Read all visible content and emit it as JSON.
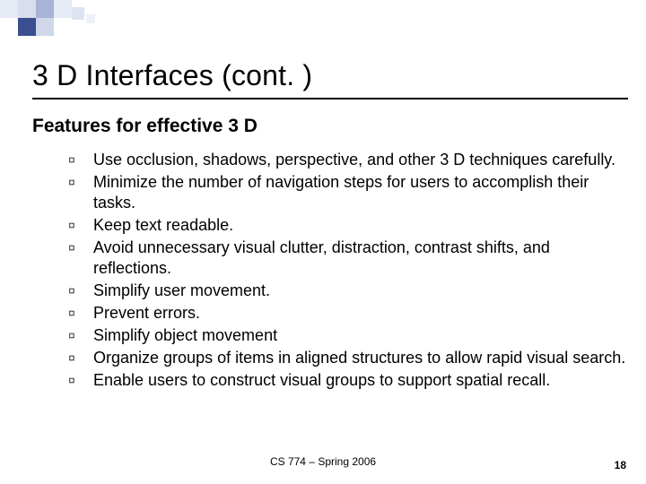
{
  "title": "3 D Interfaces (cont. )",
  "subhead": "Features for effective 3 D",
  "bullets": [
    "Use occlusion, shadows, perspective, and other 3 D techniques carefully.",
    "Minimize the number of navigation steps for users to accomplish their tasks.",
    "Keep text readable.",
    "Avoid unnecessary visual clutter, distraction, contrast shifts, and reflections.",
    "Simplify user movement.",
    "Prevent errors.",
    "Simplify object movement",
    "Organize groups of items in aligned structures to allow rapid visual search.",
    "Enable users to construct visual groups to support spatial recall."
  ],
  "bullet_glyph": "¤",
  "footer": {
    "course": "CS 774 – Spring 2006",
    "page": "18"
  }
}
